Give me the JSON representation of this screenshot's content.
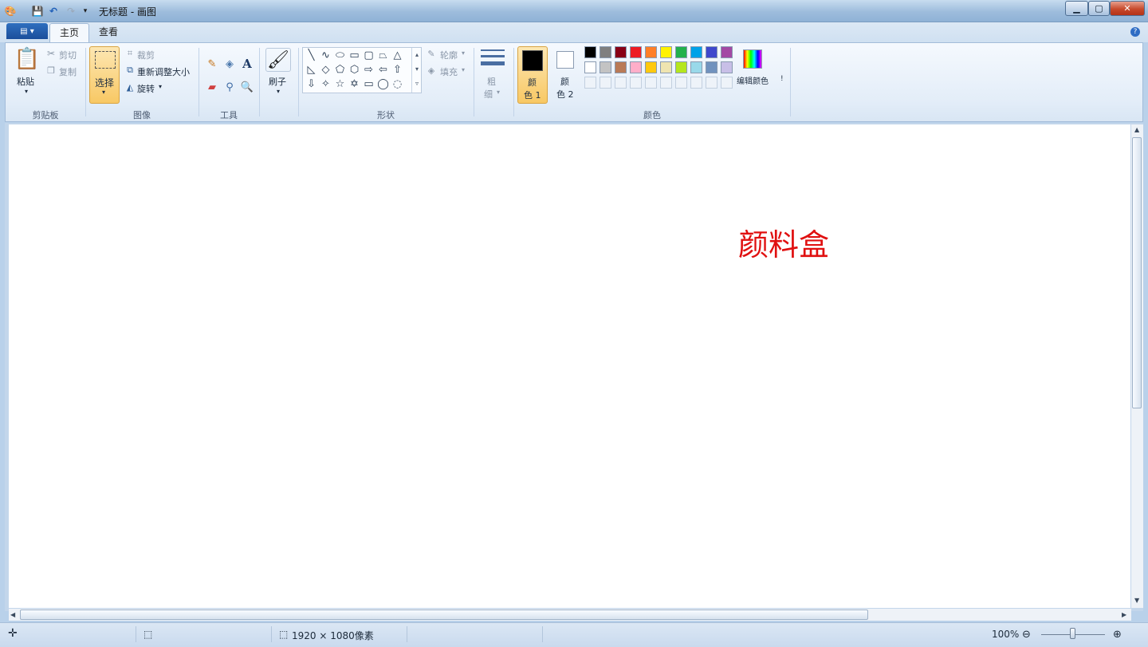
{
  "window": {
    "title": "无标题 - 画图"
  },
  "tabs": {
    "home": "主页",
    "view": "查看"
  },
  "clipboard": {
    "paste": "粘贴",
    "cut": "剪切",
    "copy": "复制",
    "group": "剪贴板"
  },
  "image": {
    "select": "选择",
    "crop": "裁剪",
    "resize": "重新调整大小",
    "rotate": "旋转",
    "group": "图像"
  },
  "tools": {
    "group": "工具"
  },
  "brushes": {
    "label": "刷子"
  },
  "shapes": {
    "outline": "轮廓",
    "fill": "填充",
    "group": "形状"
  },
  "size": {
    "label1": "粗",
    "label2": "细"
  },
  "colors": {
    "color1_a": "颜",
    "color1_b": "色 1",
    "color2_a": "颜",
    "color2_b": "色 2",
    "edit": "编辑颜色",
    "group": "颜色",
    "color1_value": "#000000",
    "color2_value": "#ffffff",
    "palette_row1": [
      "#000000",
      "#7f7f7f",
      "#880015",
      "#ed1c24",
      "#ff7f27",
      "#fff200",
      "#22b14c",
      "#00a2e8",
      "#3f48cc",
      "#a349a4"
    ],
    "palette_row2": [
      "#ffffff",
      "#c3c3c3",
      "#b97a57",
      "#ffaec9",
      "#ffc90e",
      "#efe4b0",
      "#b5e61d",
      "#99d9ea",
      "#7092be",
      "#c8bfe7"
    ]
  },
  "canvas": {
    "text": "颜料盒",
    "text_color": "#e01010"
  },
  "status": {
    "image_size": "1920 × 1080像素",
    "zoom": "100%"
  }
}
